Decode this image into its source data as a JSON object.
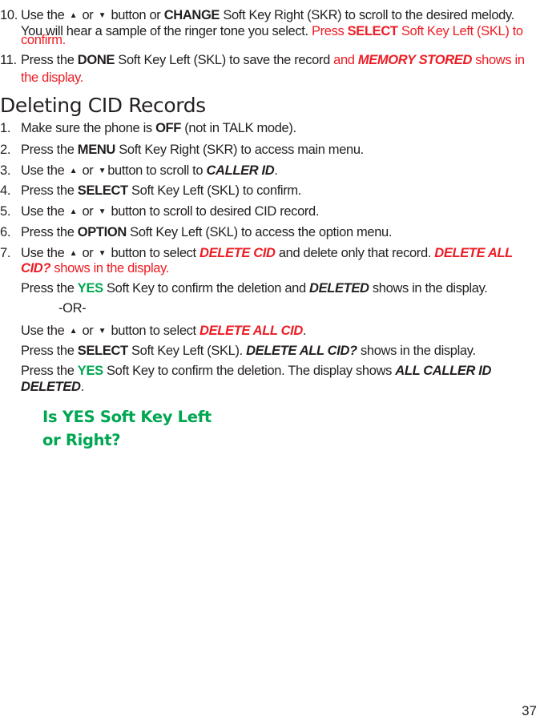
{
  "steps_top": [
    {
      "number": "10.",
      "lines": [
        [
          "Use the ",
          "ARROW_UP",
          " or ",
          "ARROW_DOWN",
          " button or ",
          "B:CHANGE",
          " Soft Key Right (SKR) to scroll to the desired melody."
        ],
        [
          "You will hear a sample of the ringer tone you select. ",
          "R:Press ",
          "RB:SELECT",
          "R: Soft Key Left (SKL) to"
        ],
        [
          "R:confirm."
        ]
      ]
    },
    {
      "number": "11.",
      "lines": [
        [
          "Press the ",
          "B:DONE",
          " Soft Key Left (SKL) to save the record ",
          "R:and ",
          "RBI:MEMORY STORED",
          "R: shows in"
        ],
        [
          "R:the display."
        ]
      ]
    }
  ],
  "section": {
    "title": "Deleting CID Records"
  },
  "steps": [
    {
      "number": "1.",
      "lines": [
        [
          "Make sure the phone is ",
          "B:OFF",
          " (not in TALK mode)."
        ]
      ]
    },
    {
      "number": "2.",
      "lines": [
        [
          "Press the ",
          "B:MENU",
          " Soft Key Right (SKR) to access main menu."
        ]
      ]
    },
    {
      "number": "3.",
      "lines": [
        [
          "Use the ",
          "ARROW_UP",
          " or ",
          "ARROW_DOWN",
          "button to scroll to ",
          "BI:CALLER ID",
          "."
        ]
      ]
    },
    {
      "number": "4.",
      "lines": [
        [
          "Press the ",
          "B:SELECT",
          " Soft Key Left (SKL) to confirm."
        ]
      ]
    },
    {
      "number": "5.",
      "lines": [
        [
          "Use the ",
          "ARROW_UP",
          " or ",
          "ARROW_DOWN",
          " button to scroll to desired CID record."
        ]
      ]
    },
    {
      "number": "6.",
      "lines": [
        [
          "Press the ",
          "B:OPTION",
          " Soft Key Left (SKL) to access the option menu."
        ]
      ]
    },
    {
      "number": "7.",
      "lines": [
        [
          "Use the ",
          "ARROW_UP",
          " or ",
          "ARROW_DOWN",
          " button to select ",
          "RBI:DELETE CID",
          " and delete only that record. ",
          "RBI:DELETE ALL"
        ],
        [
          "RBI:CID?",
          "R: shows in the display."
        ],
        [
          "Press the ",
          "GB:YES",
          " Soft Key to confirm the deletion and ",
          "BI:DELETED",
          " shows in the display."
        ],
        [
          "INDENT:-OR-"
        ],
        [
          "Use the ",
          "ARROW_UP",
          " or ",
          "ARROW_DOWN",
          " button to select ",
          "RBI:DELETE ALL CID",
          "."
        ],
        [
          "Press the ",
          "B:SELECT",
          " Soft Key Left (SKL). ",
          "BI:DELETE ALL CID?",
          " shows in the display."
        ],
        [
          "Press the ",
          "GB:YES",
          " Soft Key to confirm the deletion. The display shows ",
          "BI:ALL CALLER ID"
        ],
        [
          "BI:DELETED",
          "."
        ]
      ]
    }
  ],
  "note": {
    "line1": "Is YES Soft Key Left",
    "line2": "or Right?"
  },
  "icons": {
    "arrow_up": "▲",
    "arrow_down": "▼"
  },
  "colors": {
    "text": "#231f20",
    "highlight_red": "#ed1c24",
    "highlight_green": "#00a651"
  },
  "page_number": "37"
}
